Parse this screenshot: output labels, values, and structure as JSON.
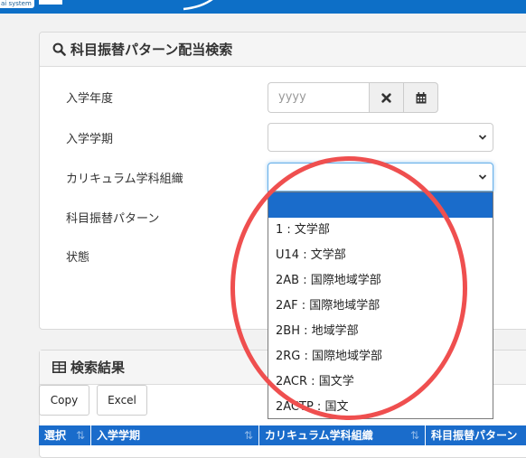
{
  "header": {
    "logo_text": "ai system"
  },
  "search_panel": {
    "title": "科目振替パターン配当検索",
    "fields": {
      "year_label": "入学年度",
      "year_placeholder": "yyyy",
      "term_label": "入学学期",
      "curriculum_label": "カリキュラム学科組織",
      "pattern_label": "科目振替パターン",
      "status_label": "状態"
    }
  },
  "dropdown": {
    "options": [
      "",
      "1 : 文学部",
      "U14 : 文学部",
      "2AB : 国際地域学部",
      "2AF : 国際地域学部",
      "2BH : 地域学部",
      "2RG : 国際地域学部",
      "2ACR : 国文学",
      "2ACTP : 国文"
    ]
  },
  "results_panel": {
    "title": "検索結果",
    "copy_label": "Copy",
    "excel_label": "Excel",
    "columns": [
      "選択",
      "入学学期",
      "カリキュラム学科組織",
      "科目振替パターン"
    ]
  },
  "colors": {
    "header": "#0d6fc7",
    "selected": "#1a6ccb",
    "annotation": "#ef4f4f"
  }
}
